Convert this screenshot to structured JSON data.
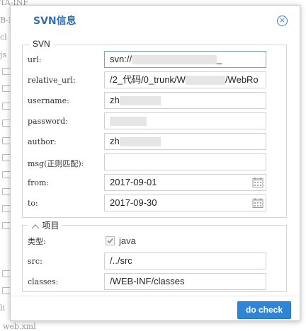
{
  "background": {
    "lines": [
      "TA-INF",
      "B-I",
      "cl",
      "js",
      "li",
      "web.xml"
    ]
  },
  "dialog": {
    "title": "SVN信息",
    "close_glyph": "×",
    "svn_panel": {
      "legend": "SVN",
      "fields": [
        {
          "key": "url",
          "label": "url:",
          "value_prefix": "svn://",
          "value_suffix": "_"
        },
        {
          "key": "relative_url",
          "label": "relative_url:",
          "value_prefix": "/2_代码/0_trunk/W",
          "value_suffix": "/WebRo"
        },
        {
          "key": "username",
          "label": "username:",
          "value_prefix": "zh",
          "value_suffix": ""
        },
        {
          "key": "password",
          "label": "password:",
          "value_prefix": "",
          "value_suffix": ""
        },
        {
          "key": "author",
          "label": "author:",
          "value_prefix": "zh",
          "value_suffix": ""
        },
        {
          "key": "msg",
          "label": "msg(正则匹配):",
          "value_prefix": "",
          "value_suffix": ""
        },
        {
          "key": "from",
          "label": "from:",
          "value_prefix": "2017-09-01",
          "value_suffix": ""
        },
        {
          "key": "to",
          "label": "to:",
          "value_prefix": "2017-09-30",
          "value_suffix": ""
        }
      ]
    },
    "project_panel": {
      "legend": "项目",
      "type_label": "类型:",
      "type_option": "java",
      "type_checked": true,
      "src_label": "src:",
      "src_value": "/../src",
      "classes_label": "classes:",
      "classes_value": "/WEB-INF/classes"
    },
    "do_check_label": "do check"
  },
  "colors": {
    "title": "#2f6fb5",
    "button": "#2f84d6",
    "focus_border": "#6fa6dc"
  }
}
